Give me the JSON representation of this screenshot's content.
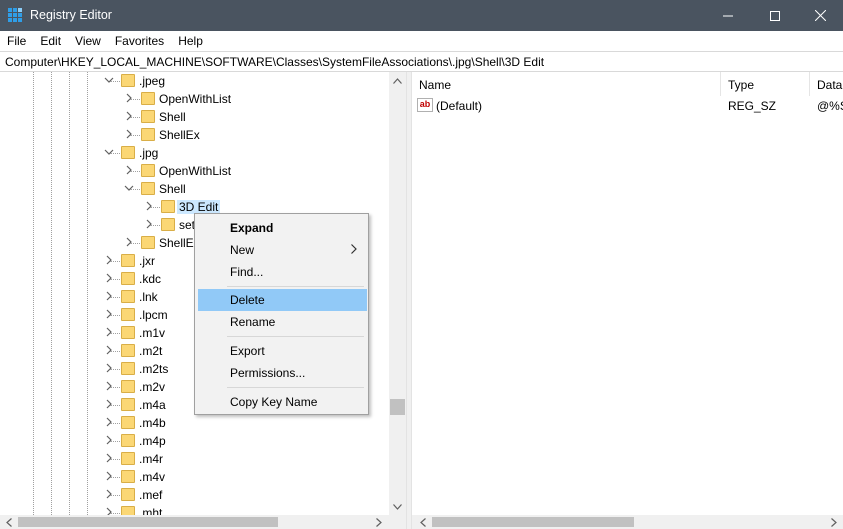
{
  "window": {
    "title": "Registry Editor",
    "titlebar_color": "#4a5460"
  },
  "menu": {
    "items": [
      "File",
      "Edit",
      "View",
      "Favorites",
      "Help"
    ]
  },
  "address": {
    "path": "Computer\\HKEY_LOCAL_MACHINE\\SOFTWARE\\Classes\\SystemFileAssociations\\.jpg\\Shell\\3D Edit"
  },
  "tree": {
    "rows": [
      {
        "label": ".jpeg",
        "state": "expanded"
      },
      {
        "label": "OpenWithList",
        "state": "collapsed"
      },
      {
        "label": "Shell",
        "state": "collapsed"
      },
      {
        "label": "ShellEx",
        "state": "collapsed"
      },
      {
        "label": ".jpg",
        "state": "expanded"
      },
      {
        "label": "OpenWithList",
        "state": "collapsed"
      },
      {
        "label": "Shell",
        "state": "expanded"
      },
      {
        "label": "3D Edit",
        "state": "collapsed",
        "selected": true
      },
      {
        "label": "set",
        "state": "collapsed"
      },
      {
        "label": "ShellEx",
        "state": "collapsed"
      },
      {
        "label": ".jxr",
        "state": "collapsed"
      },
      {
        "label": ".kdc",
        "state": "collapsed"
      },
      {
        "label": ".lnk",
        "state": "collapsed"
      },
      {
        "label": ".lpcm",
        "state": "collapsed"
      },
      {
        "label": ".m1v",
        "state": "collapsed"
      },
      {
        "label": ".m2t",
        "state": "collapsed"
      },
      {
        "label": ".m2ts",
        "state": "collapsed"
      },
      {
        "label": ".m2v",
        "state": "collapsed"
      },
      {
        "label": ".m4a",
        "state": "collapsed"
      },
      {
        "label": ".m4b",
        "state": "collapsed"
      },
      {
        "label": ".m4p",
        "state": "collapsed"
      },
      {
        "label": ".m4r",
        "state": "collapsed"
      },
      {
        "label": ".m4v",
        "state": "collapsed"
      },
      {
        "label": ".mef",
        "state": "collapsed"
      },
      {
        "label": ".mht",
        "state": "collapsed"
      }
    ]
  },
  "list": {
    "columns": [
      "Name",
      "Type",
      "Data"
    ],
    "rows": [
      {
        "icon": "string-value-icon",
        "icon_text": "ab",
        "name": "(Default)",
        "type": "REG_SZ",
        "data": "@%S"
      }
    ]
  },
  "context_menu": {
    "items": [
      {
        "label": "Expand",
        "bold": true
      },
      {
        "label": "New",
        "submenu": true
      },
      {
        "label": "Find..."
      },
      {
        "label": "Delete",
        "highlighted": true
      },
      {
        "label": "Rename"
      },
      {
        "label": "Export"
      },
      {
        "label": "Permissions..."
      },
      {
        "label": "Copy Key Name"
      }
    ],
    "highlight_color": "#91c9f7"
  }
}
